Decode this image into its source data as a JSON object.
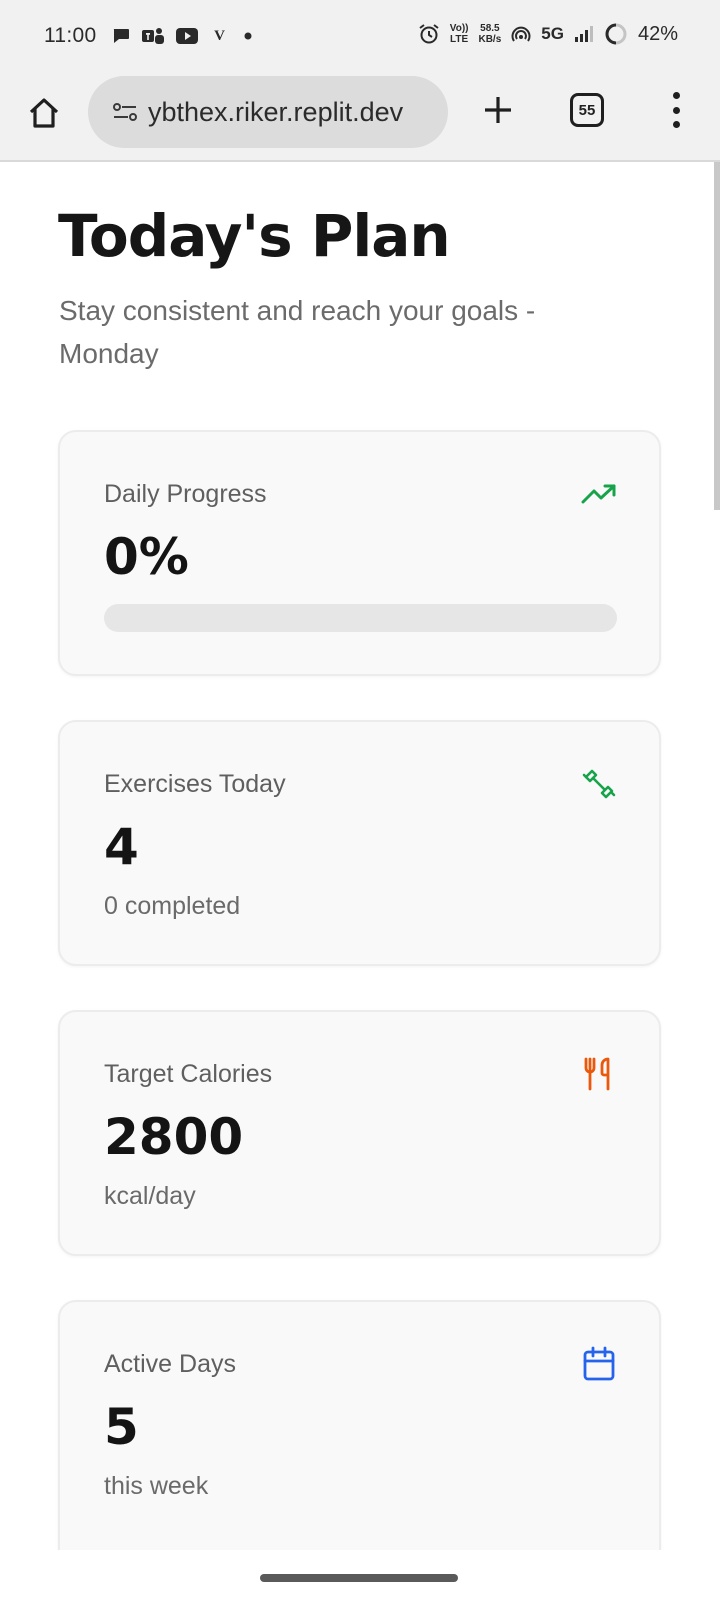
{
  "status_bar": {
    "time": "11:00",
    "app_icons": [
      "message-icon",
      "teams-icon",
      "youtube-icon",
      "v-icon",
      "dot-icon"
    ],
    "v_letter": "V",
    "volte_top": "Vo))",
    "volte_bottom": "LTE",
    "speed_top": "58.5",
    "speed_bottom": "KB/s",
    "network": "5G",
    "battery": "42%"
  },
  "browser": {
    "url": "ybthex.riker.replit.dev",
    "tab_count": "55"
  },
  "page": {
    "title": "Today's Plan",
    "subtitle": "Stay consistent and reach your goals - Monday"
  },
  "cards": {
    "progress": {
      "label": "Daily Progress",
      "value": "0%",
      "progress_fraction": 0,
      "icon": "trending-up-icon",
      "icon_color": "#16a34a"
    },
    "exercises": {
      "label": "Exercises Today",
      "value": "4",
      "sub": "0 completed",
      "icon": "dumbbell-icon",
      "icon_color": "#16a34a"
    },
    "calories": {
      "label": "Target Calories",
      "value": "2800",
      "sub": "kcal/day",
      "icon": "utensils-icon",
      "icon_color": "#ea580c"
    },
    "active_days": {
      "label": "Active Days",
      "value": "5",
      "sub": "this week",
      "icon": "calendar-icon",
      "icon_color": "#2563eb"
    }
  }
}
